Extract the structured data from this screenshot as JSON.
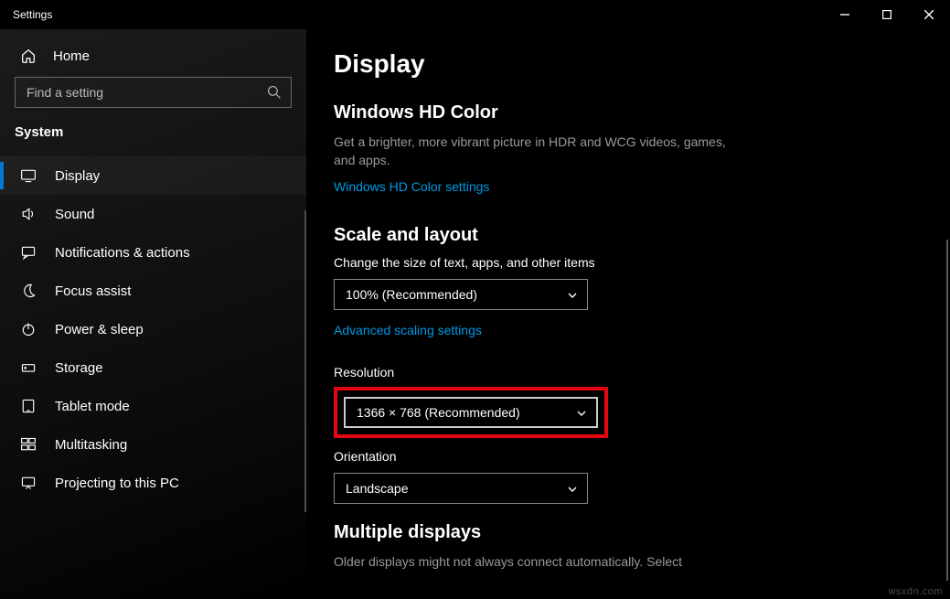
{
  "window": {
    "title": "Settings"
  },
  "sidebar": {
    "home": "Home",
    "search_placeholder": "Find a setting",
    "category": "System",
    "items": [
      {
        "label": "Display",
        "icon": "monitor-icon",
        "active": true
      },
      {
        "label": "Sound",
        "icon": "speaker-icon"
      },
      {
        "label": "Notifications & actions",
        "icon": "message-icon"
      },
      {
        "label": "Focus assist",
        "icon": "moon-icon"
      },
      {
        "label": "Power & sleep",
        "icon": "power-icon"
      },
      {
        "label": "Storage",
        "icon": "storage-icon"
      },
      {
        "label": "Tablet mode",
        "icon": "tablet-icon"
      },
      {
        "label": "Multitasking",
        "icon": "multitask-icon"
      },
      {
        "label": "Projecting to this PC",
        "icon": "project-icon"
      }
    ]
  },
  "main": {
    "title": "Display",
    "hd": {
      "heading": "Windows HD Color",
      "desc": "Get a brighter, more vibrant picture in HDR and WCG videos, games, and apps.",
      "link": "Windows HD Color settings"
    },
    "scale": {
      "heading": "Scale and layout",
      "size_label": "Change the size of text, apps, and other items",
      "size_value": "100% (Recommended)",
      "adv_link": "Advanced scaling settings",
      "res_label": "Resolution",
      "res_value": "1366 × 768 (Recommended)",
      "orient_label": "Orientation",
      "orient_value": "Landscape"
    },
    "multi": {
      "heading": "Multiple displays",
      "desc": "Older displays might not always connect automatically. Select"
    }
  },
  "watermark": "wsxdn.com"
}
